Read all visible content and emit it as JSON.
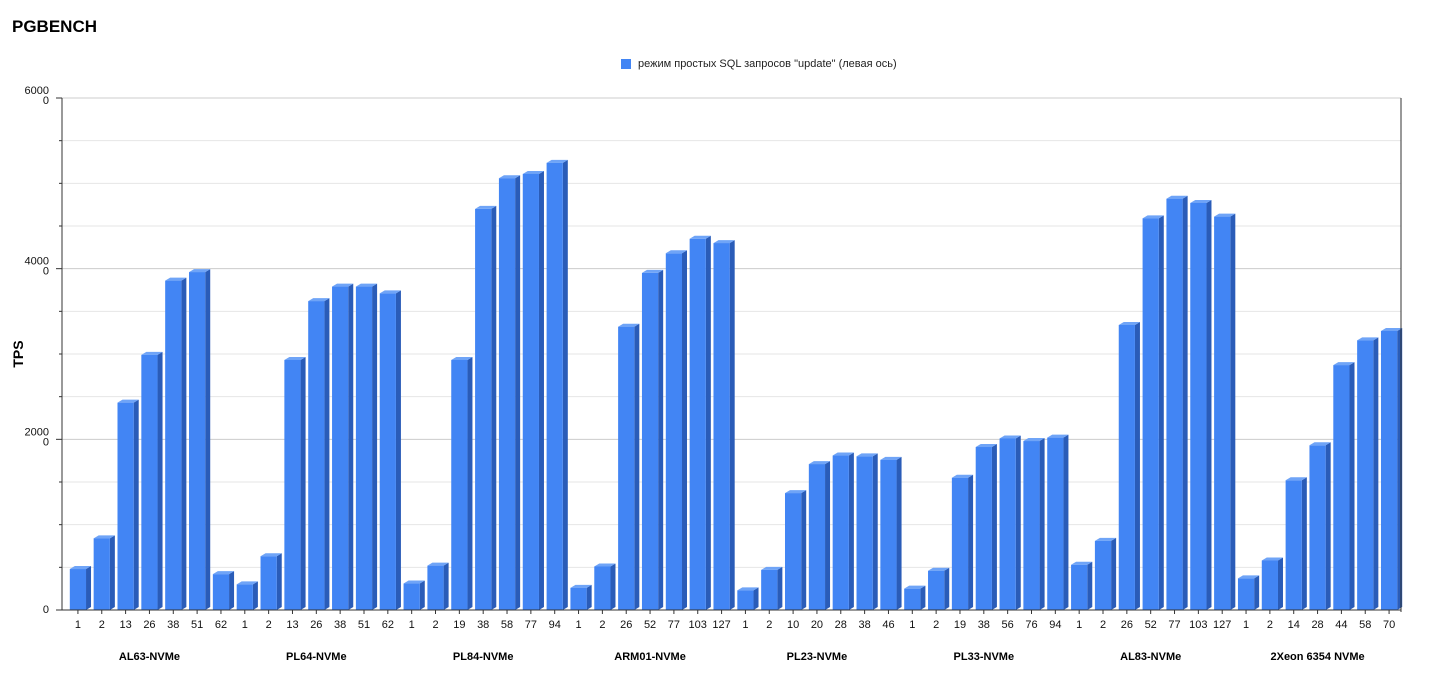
{
  "page": {
    "title": "PGBENCH"
  },
  "colors": {
    "bar_front": "#4285f4",
    "bar_side": "#2a5cb8",
    "bar_top": "#6fa4f7",
    "grid": "#d9d9d9",
    "axis": "#333333"
  },
  "chart_data": {
    "type": "bar",
    "title": "PGBENCH",
    "xlabel": "",
    "ylabel": "TPS",
    "ylim": [
      0,
      6000
    ],
    "y_tick_labels": [
      "0",
      "2000\n0",
      "4000\n0",
      "6000\n0"
    ],
    "grid": true,
    "legend_position": "top-center",
    "series": [
      {
        "name": "режим простых SQL запросов \"update\" (левая ось)"
      }
    ],
    "groups": [
      {
        "name": "AL63-NVMe",
        "categories": [
          "1",
          "2",
          "13",
          "26",
          "38",
          "51",
          "62"
        ],
        "values": [
          480,
          840,
          2430,
          2990,
          3860,
          3960,
          420
        ]
      },
      {
        "name": "PL64-NVMe",
        "categories": [
          "1",
          "2",
          "13",
          "26",
          "38",
          "51",
          "62"
        ],
        "values": [
          300,
          630,
          2930,
          3620,
          3790,
          3790,
          3710
        ]
      },
      {
        "name": "PL84-NVMe",
        "categories": [
          "1",
          "2",
          "19",
          "38",
          "58",
          "77",
          "94"
        ],
        "values": [
          310,
          520,
          2930,
          4700,
          5060,
          5110,
          5240
        ]
      },
      {
        "name": "ARM01-NVMe",
        "categories": [
          "1",
          "2",
          "26",
          "52",
          "77",
          "103",
          "127"
        ],
        "values": [
          260,
          510,
          3320,
          3950,
          4180,
          4350,
          4300
        ]
      },
      {
        "name": "PL23-NVMe",
        "categories": [
          "1",
          "2",
          "10",
          "20",
          "28",
          "38",
          "46"
        ],
        "values": [
          230,
          470,
          1370,
          1710,
          1810,
          1800,
          1760
        ]
      },
      {
        "name": "PL33-NVMe",
        "categories": [
          "1",
          "2",
          "19",
          "38",
          "56",
          "76",
          "94"
        ],
        "values": [
          250,
          460,
          1550,
          1910,
          2010,
          1980,
          2020
        ]
      },
      {
        "name": "AL83-NVMe",
        "categories": [
          "1",
          "2",
          "26",
          "52",
          "77",
          "103",
          "127"
        ],
        "values": [
          530,
          810,
          3340,
          4590,
          4820,
          4770,
          4610
        ]
      },
      {
        "name": "2Xeon 6354 NVMe",
        "categories": [
          "1",
          "2",
          "14",
          "28",
          "44",
          "58",
          "70"
        ],
        "values": [
          370,
          580,
          1520,
          1930,
          2870,
          3160,
          3270
        ]
      }
    ]
  }
}
